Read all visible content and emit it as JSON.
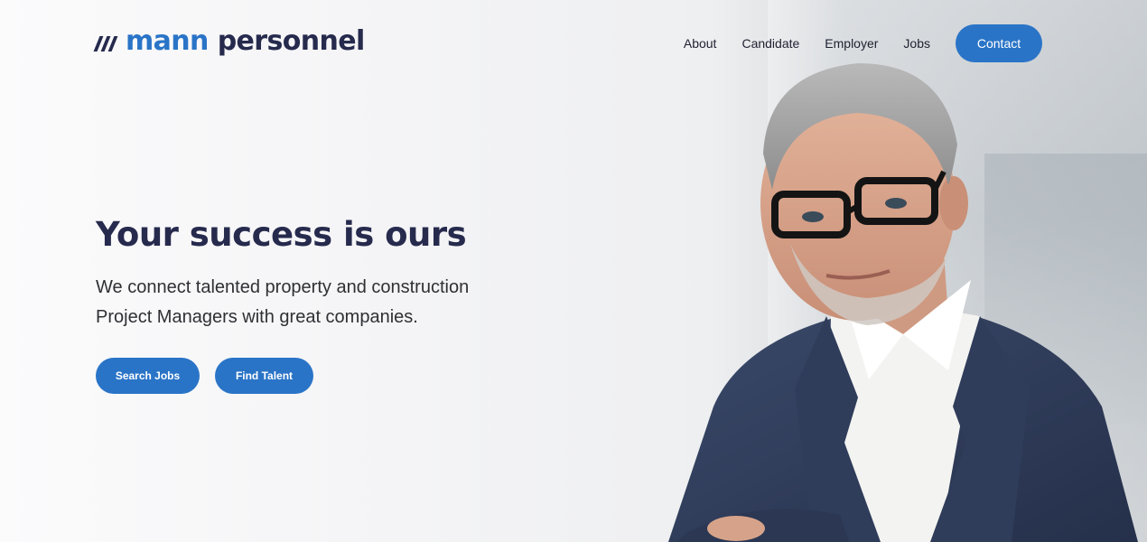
{
  "brand": {
    "name_part1": "mann",
    "name_part2": "personnel",
    "accent_color": "#2a74c7",
    "dark_color": "#262a4d"
  },
  "nav": {
    "items": [
      {
        "label": "About"
      },
      {
        "label": "Candidate"
      },
      {
        "label": "Employer"
      },
      {
        "label": "Jobs"
      }
    ],
    "contact_label": "Contact"
  },
  "hero": {
    "title": "Your success is ours",
    "subtitle_line1": "We connect talented property and construction",
    "subtitle_line2": "Project Managers with great companies.",
    "search_button": "Search Jobs",
    "talent_button": "Find Talent"
  }
}
